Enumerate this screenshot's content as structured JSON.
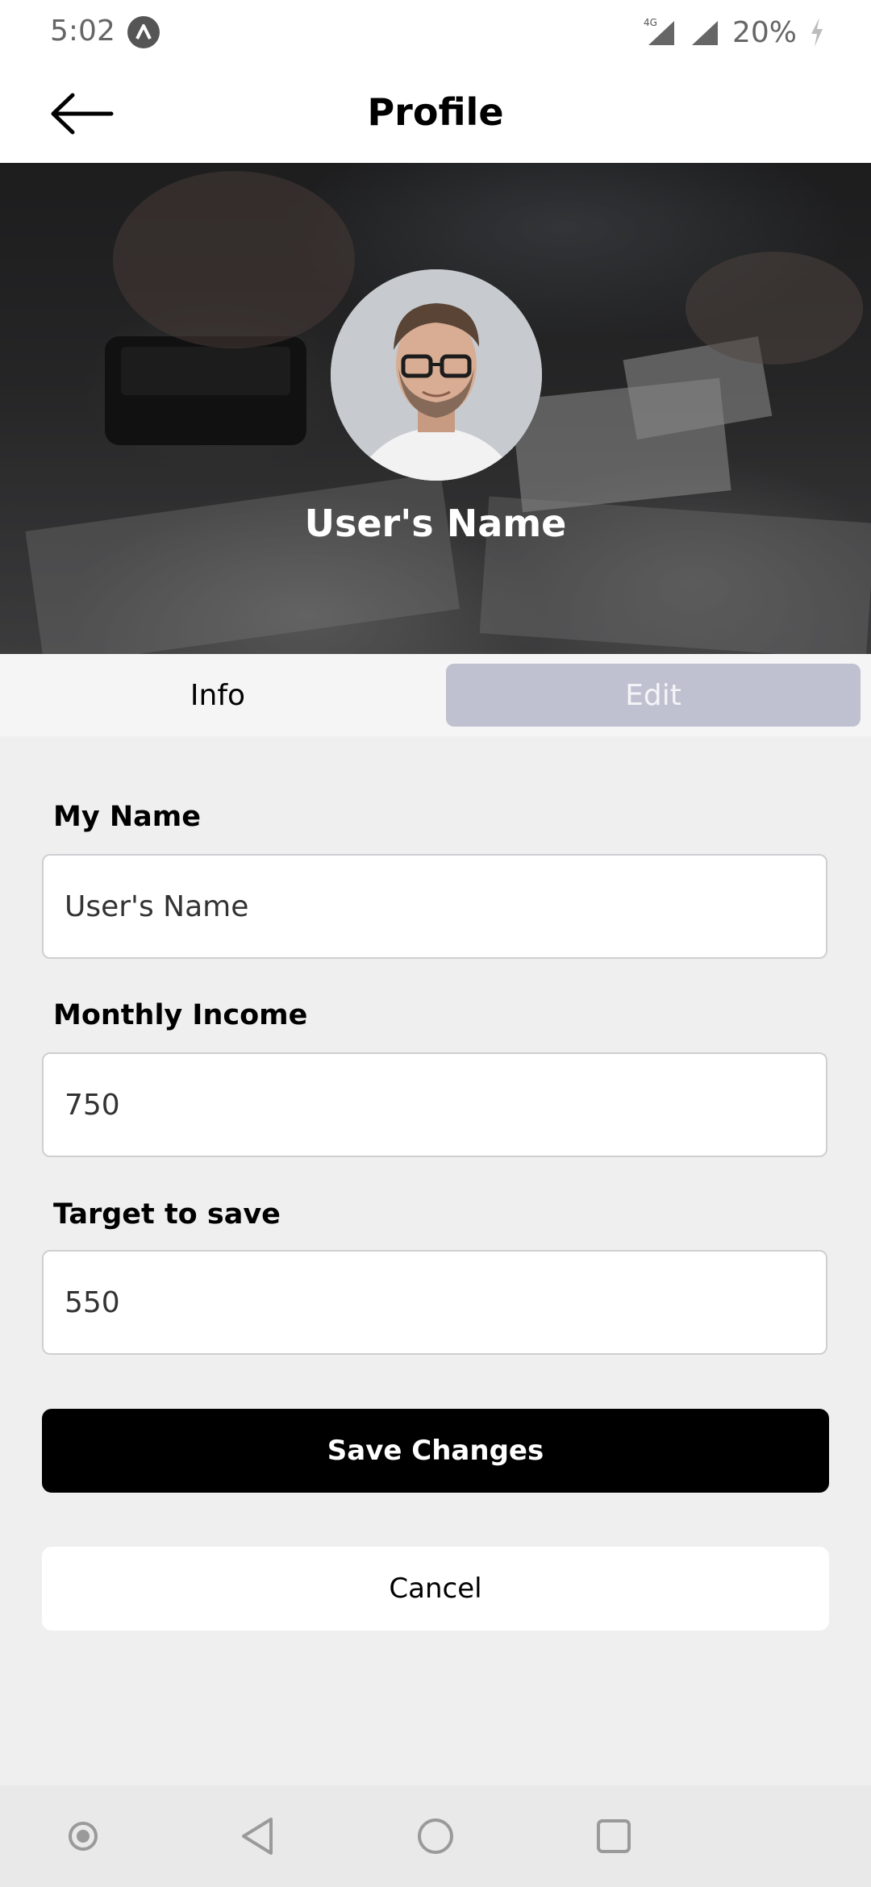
{
  "status_bar": {
    "time": "5:02",
    "network": "4G",
    "battery": "20%"
  },
  "header": {
    "title": "Profile",
    "back_icon": "arrow-left-icon"
  },
  "hero": {
    "user_name": "User's Name"
  },
  "tabs": [
    {
      "label": "Info",
      "active": false
    },
    {
      "label": "Edit",
      "active": true
    }
  ],
  "form": {
    "name": {
      "label": "My Name",
      "value": "User's Name"
    },
    "income": {
      "label": "Monthly Income",
      "value": "750"
    },
    "target": {
      "label": "Target to save",
      "value": "550"
    }
  },
  "actions": {
    "save_label": "Save Changes",
    "cancel_label": "Cancel"
  },
  "colors": {
    "accent": "#000000",
    "tab_active_bg": "#bfc1d0",
    "background": "#efeff0"
  }
}
